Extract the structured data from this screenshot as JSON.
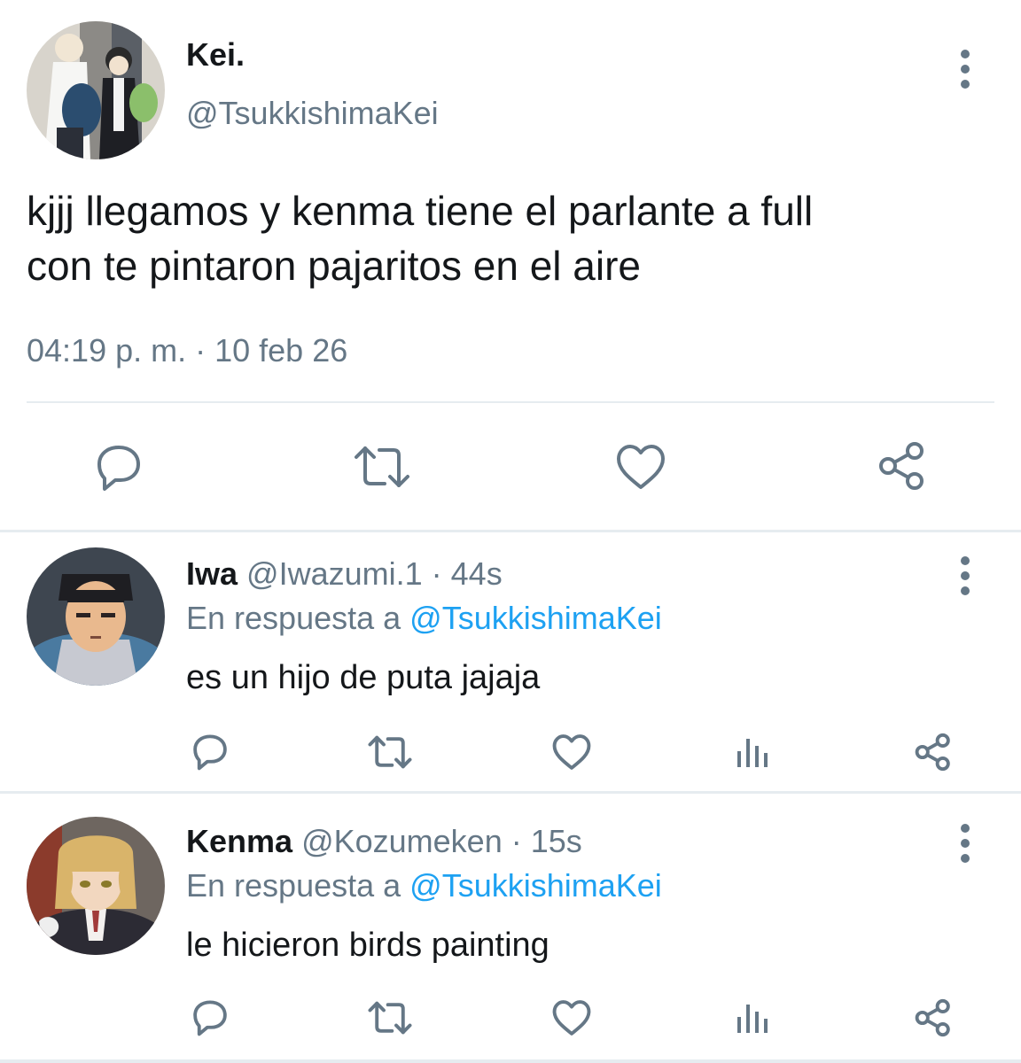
{
  "main_tweet": {
    "author_name": "Kei.",
    "author_handle": "@TsukkishimaKei",
    "text_line1": "kjjj llegamos y kenma tiene el parlante a full",
    "text_line2": "con te pintaron pajaritos en el aire",
    "timestamp": "04:19 p. m. · 10 feb 26",
    "actions": [
      "reply-icon",
      "retweet-icon",
      "like-icon",
      "share-icon"
    ]
  },
  "replies": [
    {
      "author_name": "Iwa",
      "author_handle": "@Iwazumi.1",
      "time": " · 44s",
      "reply_prefix": "En respuesta a ",
      "reply_to": "@TsukkishimaKei",
      "text": "es un hijo de puta jajaja",
      "actions": [
        "reply-icon",
        "retweet-icon",
        "like-icon",
        "analytics-icon",
        "share-icon"
      ]
    },
    {
      "author_name": "Kenma",
      "author_handle": "@Kozumeken",
      "time": " · 15s",
      "reply_prefix": "En respuesta a ",
      "reply_to": "@TsukkishimaKei",
      "text": "le hicieron birds painting",
      "actions": [
        "reply-icon",
        "retweet-icon",
        "like-icon",
        "analytics-icon",
        "share-icon"
      ]
    }
  ],
  "colors": {
    "text": "#14171a",
    "secondary": "#657786",
    "link": "#1da1f2",
    "divider": "#e6ecf0"
  }
}
